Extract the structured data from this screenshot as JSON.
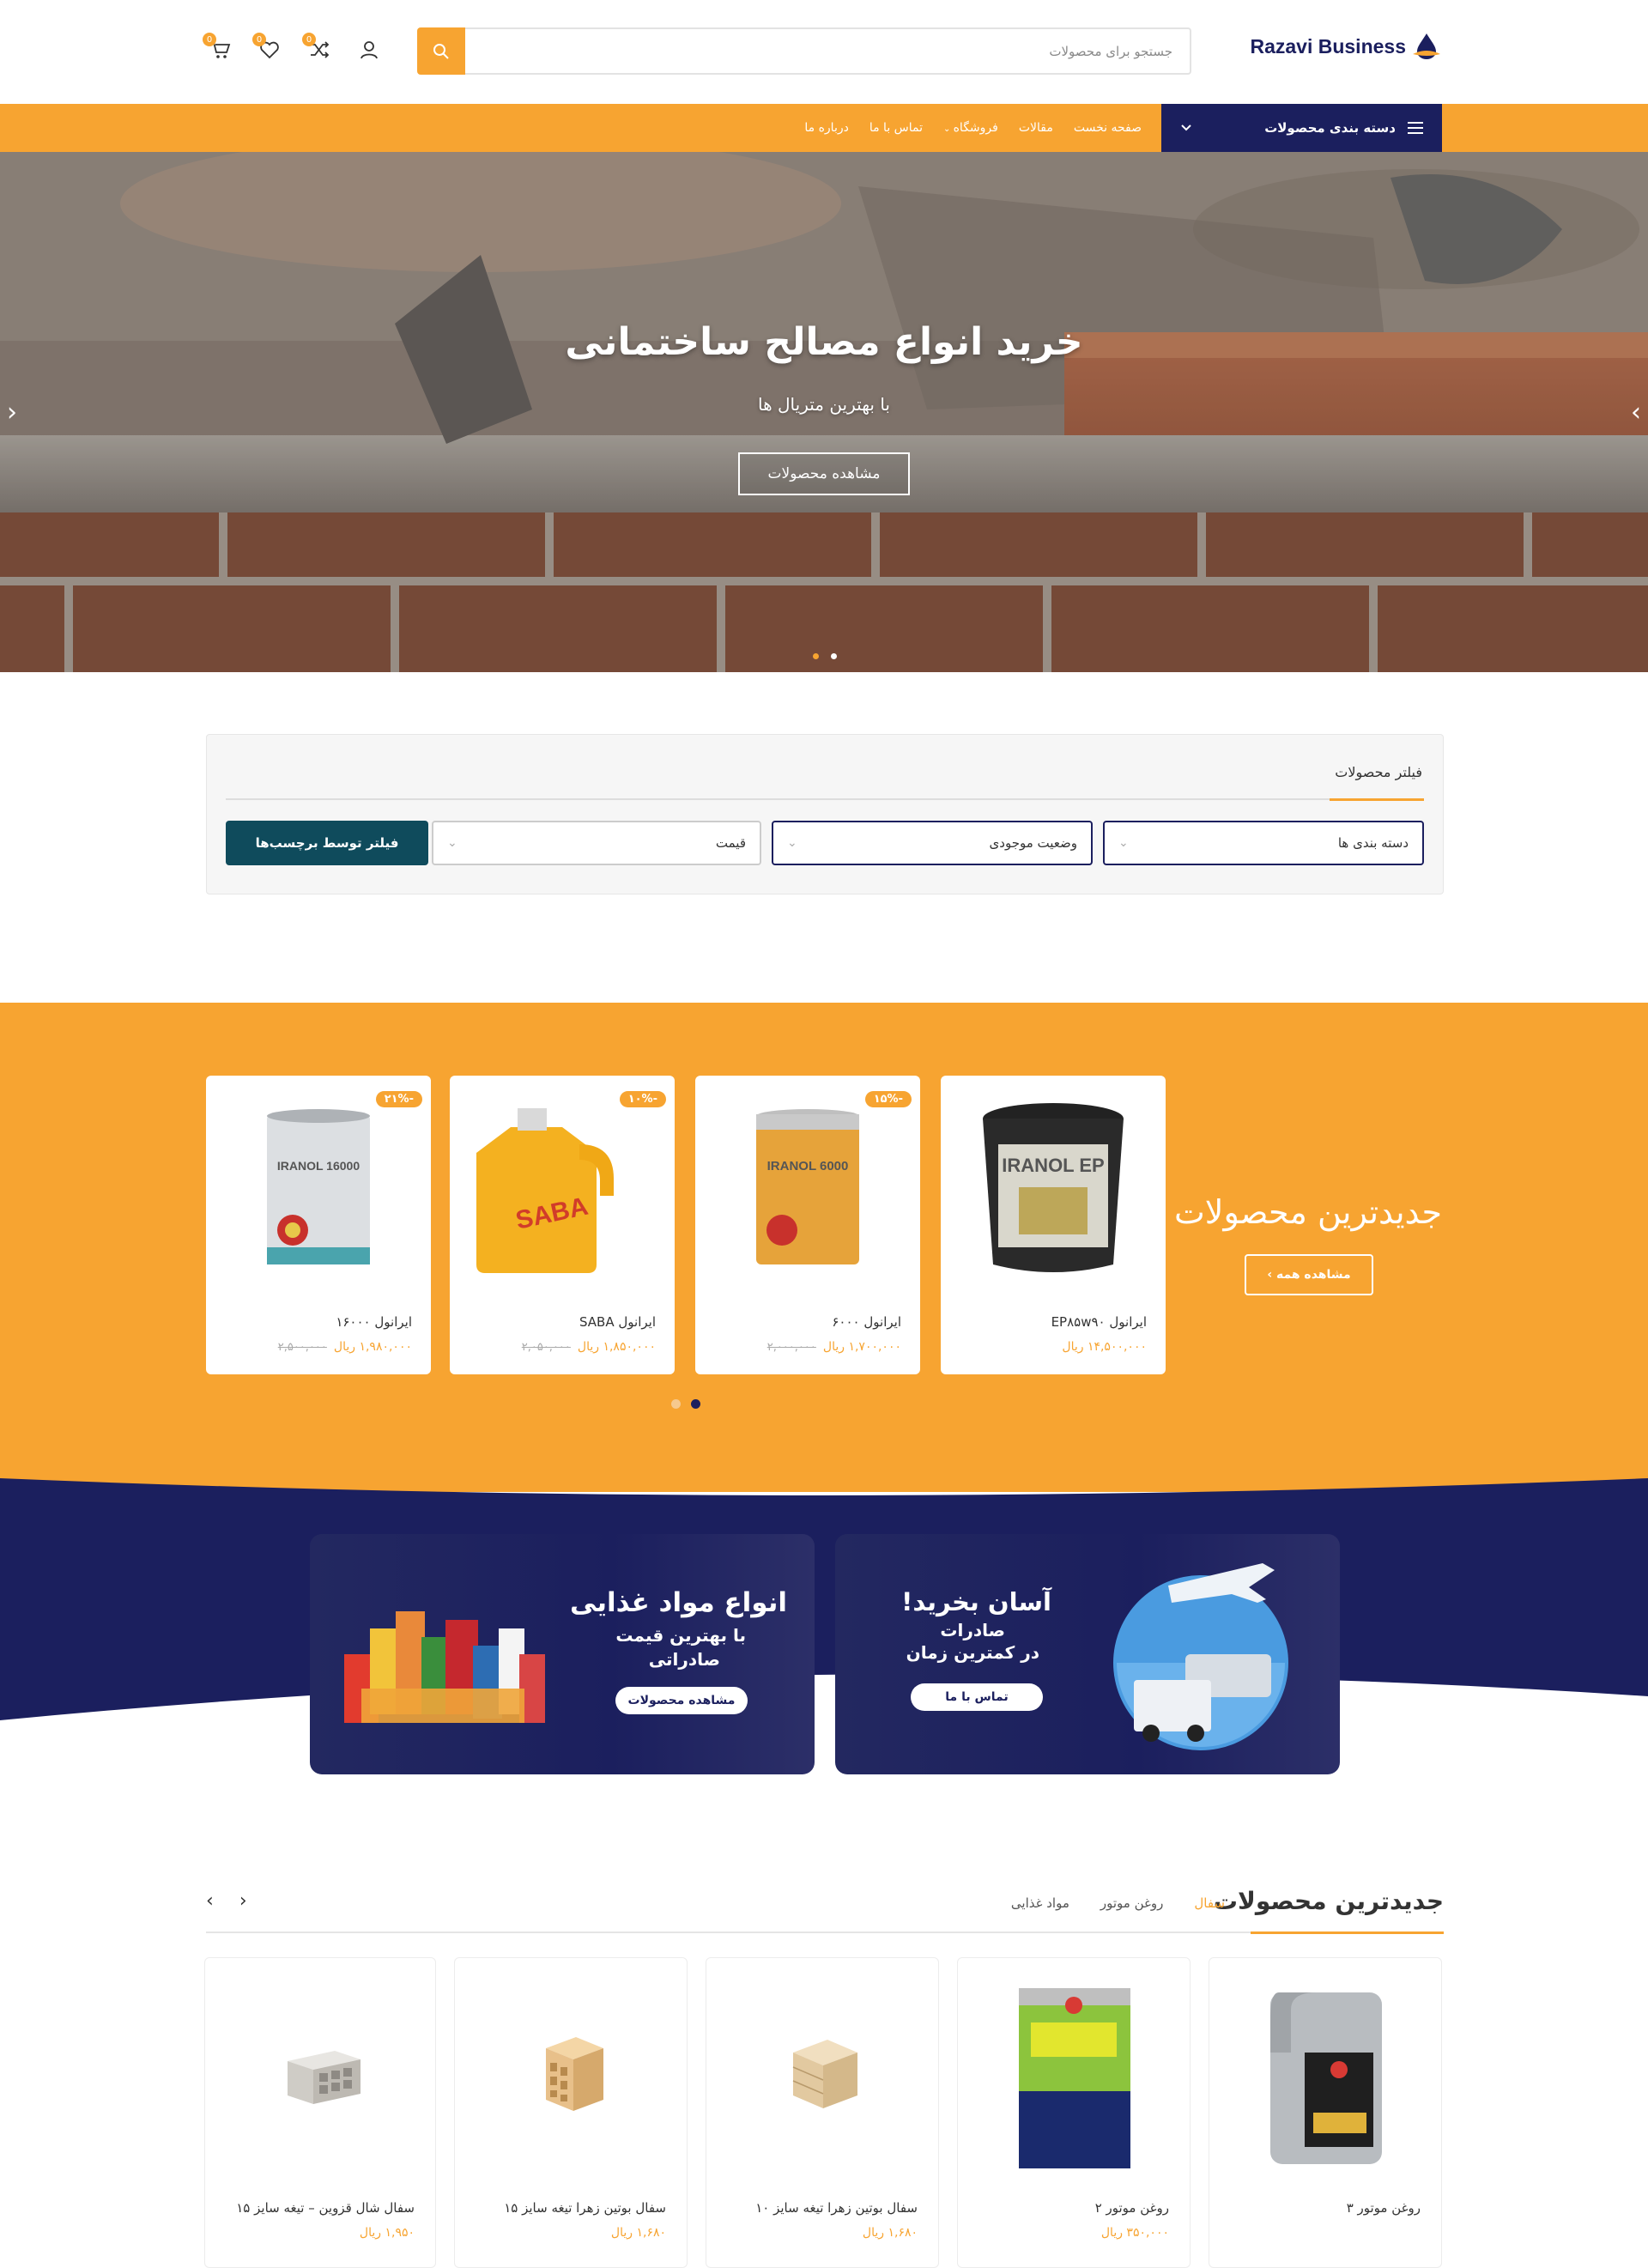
{
  "header": {
    "logo_text": "Razavi Business",
    "search_placeholder": "جستجو برای محصولات",
    "cart_count": "0",
    "wishlist_count": "0",
    "compare_count": "0"
  },
  "nav": {
    "categories_label": "دسته بندی محصولات",
    "items": [
      {
        "label": "صفحه نخست"
      },
      {
        "label": "مقالات"
      },
      {
        "label": "فروشگاه"
      },
      {
        "label": "تماس با ما"
      },
      {
        "label": "درباره ما"
      }
    ]
  },
  "hero": {
    "title": "خرید انواع مصالح ساختمانی",
    "subtitle": "با بهترین متریال ها",
    "button": "مشاهده محصولات"
  },
  "filter": {
    "title": "فیلتر محصولات",
    "selects": [
      "دسته بندی ها",
      "وضعیت موجودی",
      "قیمت"
    ],
    "tags_button": "فیلتر توسط برچسب‌ها"
  },
  "band": {
    "title": "جدیدترین محصولات",
    "see_all": "مشاهده همه ›",
    "products": [
      {
        "name": "ایرانول EP۸۵w۹۰",
        "price": "۱۴,۵۰۰,۰۰۰ ریال",
        "old_price": "",
        "discount": "",
        "label": "IRANOL EP"
      },
      {
        "name": "ایرانول ۶۰۰۰",
        "price": "۱,۷۰۰,۰۰۰ ریال",
        "old_price": "۲,۰۰۰,۰۰۰",
        "discount": "-۱۵%",
        "label": "IRANOL 6000"
      },
      {
        "name": "ایرانول SABA",
        "price": "۱,۸۵۰,۰۰۰ ریال",
        "old_price": "۲,۰۵۰,۰۰۰",
        "discount": "-۱۰%",
        "label": "SABA"
      },
      {
        "name": "ایرانول ۱۶۰۰۰",
        "price": "۱,۹۸۰,۰۰۰ ریال",
        "old_price": "۲,۵۰۰,۰۰۰",
        "discount": "-۲۱%",
        "label": "IRANOL 16000"
      }
    ]
  },
  "promos": {
    "food": {
      "title": "انواع مواد غذایی",
      "line2": "با بهترین قیمت",
      "line3": "صادراتی",
      "button": "مشاهده محصولات"
    },
    "export": {
      "title": "آسان بخرید!",
      "line2": "صادرات",
      "line3": "در کمترین زمان",
      "button": "تماس با ما"
    }
  },
  "latest": {
    "title": "جدیدترین محصولات",
    "tabs": [
      {
        "label": "سفال",
        "active": true
      },
      {
        "label": "روغن موتور",
        "active": false
      },
      {
        "label": "مواد غذایی",
        "active": false
      }
    ],
    "products": [
      {
        "name": "روغن موتور ۳",
        "price": "",
        "kind": "oil-gray"
      },
      {
        "name": "روغن موتور ۲",
        "price": "۳۵۰,۰۰۰ ریال",
        "kind": "oil-green"
      },
      {
        "name": "سفال بوتین زهرا تیغه سایز ۱۰",
        "price": "۱,۶۸۰ ریال",
        "kind": "brick"
      },
      {
        "name": "سفال بوتین زهرا تیغه سایز ۱۵",
        "price": "۱,۶۸۰ ریال",
        "kind": "brick"
      },
      {
        "name": "سفال شال قزوین – تیغه سایز ۱۵",
        "price": "۱,۹۵۰ ریال",
        "kind": "brick-gray"
      }
    ]
  },
  "colors": {
    "accent": "#f7a431",
    "navy": "#1b1f5e",
    "teal": "#0f4b5c"
  }
}
